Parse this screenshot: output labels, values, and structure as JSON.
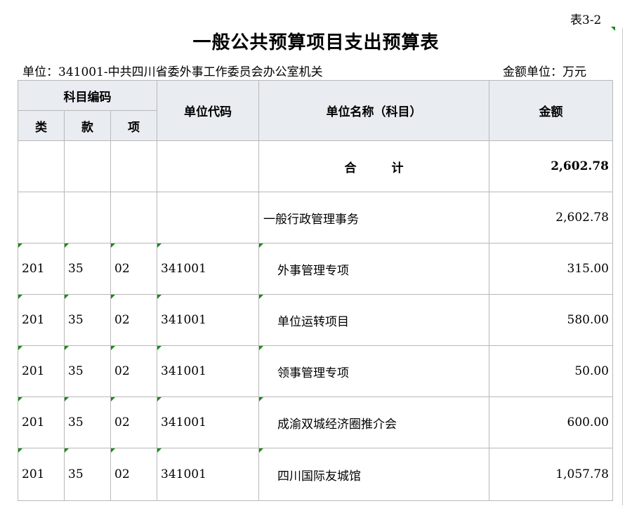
{
  "doc": {
    "table_no": "表3-2",
    "title": "一般公共预算项目支出预算表",
    "unit": "单位：341001-中共四川省委外事工作委员会办公室机关",
    "money_unit": "金额单位：万元"
  },
  "header": {
    "subject_code": "科目编码",
    "lei": "类",
    "kuan": "款",
    "xiang": "项",
    "unit_code": "单位代码",
    "unit_name": "单位名称（科目）",
    "amount": "金额"
  },
  "total": {
    "label_a": "合",
    "label_b": "计",
    "amount": "2,602.78"
  },
  "category": {
    "name": "一般行政管理事务",
    "amount": "2,602.78"
  },
  "rows": [
    {
      "lei": "201",
      "kuan": "35",
      "xiang": "02",
      "code": "341001",
      "name": "外事管理专项",
      "amount": "315.00"
    },
    {
      "lei": "201",
      "kuan": "35",
      "xiang": "02",
      "code": "341001",
      "name": "单位运转项目",
      "amount": "580.00"
    },
    {
      "lei": "201",
      "kuan": "35",
      "xiang": "02",
      "code": "341001",
      "name": "领事管理专项",
      "amount": "50.00"
    },
    {
      "lei": "201",
      "kuan": "35",
      "xiang": "02",
      "code": "341001",
      "name": "成渝双城经济圈推介会",
      "amount": "600.00"
    },
    {
      "lei": "201",
      "kuan": "35",
      "xiang": "02",
      "code": "341001",
      "name": "四川国际友城馆",
      "amount": "1,057.78"
    }
  ]
}
